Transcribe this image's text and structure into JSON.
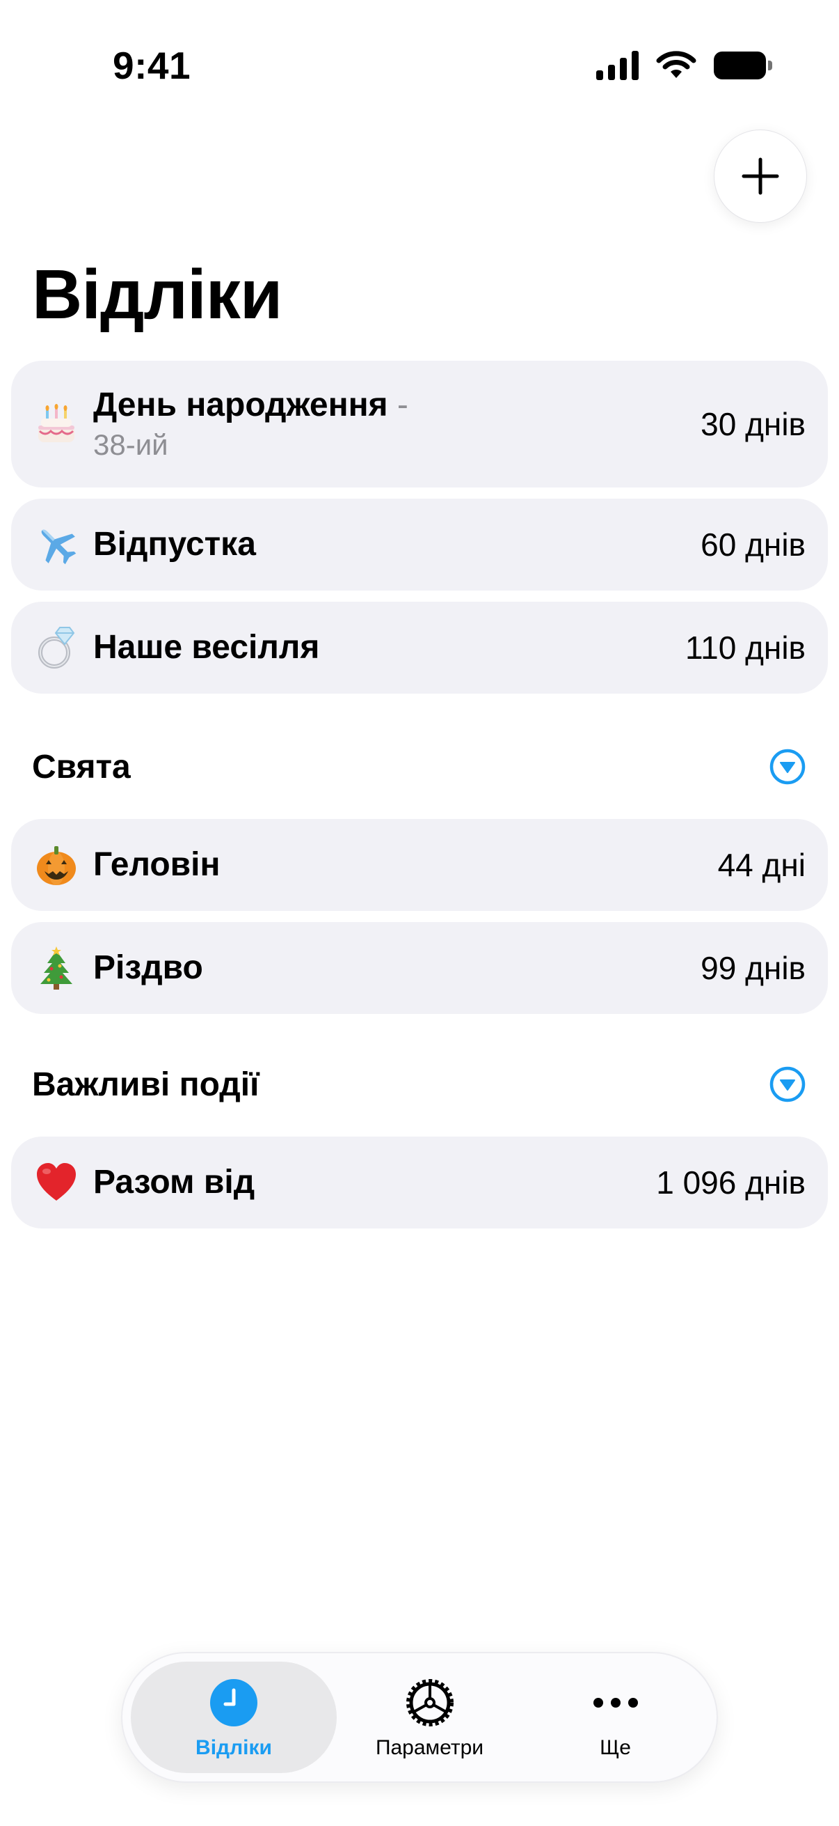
{
  "status_bar": {
    "time": "9:41",
    "icons": [
      "cellular-signal-icon",
      "wifi-icon",
      "battery-icon"
    ]
  },
  "header": {
    "title": "Відліки",
    "add_button_icon": "plus-icon"
  },
  "countdowns": [
    {
      "emoji": "🎂",
      "icon": "birthday-cake-icon",
      "title": "День народження",
      "separator": "-",
      "subtitle": "38-ий",
      "value": "30 днів"
    },
    {
      "emoji": "✈️",
      "icon": "airplane-icon",
      "title": "Відпустка",
      "value": "60 днів"
    },
    {
      "emoji": "💍",
      "icon": "ring-icon",
      "title": "Наше весілля",
      "value": "110 днів"
    }
  ],
  "sections": [
    {
      "title": "Свята",
      "toggle_icon": "chevron-down-circle-icon",
      "items": [
        {
          "emoji": "🎃",
          "icon": "pumpkin-icon",
          "title": "Геловін",
          "value": "44 дні"
        },
        {
          "emoji": "🎄",
          "icon": "christmas-tree-icon",
          "title": "Різдво",
          "value": "99 днів"
        }
      ]
    },
    {
      "title": "Важливі події",
      "toggle_icon": "chevron-down-circle-icon",
      "items": [
        {
          "emoji": "❤️",
          "icon": "heart-icon",
          "title": "Разом від",
          "value": "1 096 днів"
        }
      ]
    }
  ],
  "tab_bar": {
    "tabs": [
      {
        "label": "Відліки",
        "icon": "clock-icon",
        "active": true
      },
      {
        "label": "Параметри",
        "icon": "settings-gear-icon",
        "active": false
      },
      {
        "label": "Ще",
        "icon": "more-ellipsis-icon",
        "active": false
      }
    ]
  },
  "colors": {
    "accent": "#1a9cf2",
    "row_background": "#f1f1f6",
    "secondary_text": "#8e8e93"
  }
}
